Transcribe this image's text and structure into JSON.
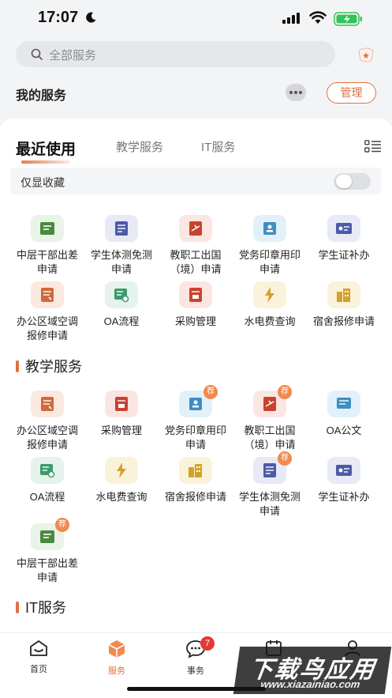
{
  "status": {
    "time": "17:07"
  },
  "search": {
    "placeholder": "全部服务"
  },
  "header": {
    "my_services": "我的服务",
    "manage_label": "管理"
  },
  "tabs": [
    {
      "label": "最近使用",
      "active": true
    },
    {
      "label": "教学服务",
      "active": false
    },
    {
      "label": "IT服务",
      "active": false
    }
  ],
  "favorites_toggle": {
    "label": "仅显收藏",
    "on": false
  },
  "recent": [
    {
      "label": "中层干部出差申请",
      "icon": "cadre-travel-icon",
      "color": "#e9f3e7",
      "accent": "#4a8a3f"
    },
    {
      "label": "学生体测免测申请",
      "icon": "fitness-exempt-icon",
      "color": "#e7e9f6",
      "accent": "#4d5aa6"
    },
    {
      "label": "教职工出国（境）申请",
      "icon": "abroad-icon",
      "color": "#fbe6e2",
      "accent": "#c8432f"
    },
    {
      "label": "党务印章用印申请",
      "icon": "seal-icon",
      "color": "#e2f1f9",
      "accent": "#3f8fbf"
    },
    {
      "label": "学生证补办",
      "icon": "student-card-icon",
      "color": "#e8eaf6",
      "accent": "#4d5aa6"
    },
    {
      "label": "办公区域空调报修申请",
      "icon": "ac-repair-icon",
      "color": "#fbe9df",
      "accent": "#d06a3c"
    },
    {
      "label": "OA流程",
      "icon": "oa-flow-icon",
      "color": "#e4f3ec",
      "accent": "#3c9b6b"
    },
    {
      "label": "采购管理",
      "icon": "purchase-icon",
      "color": "#fbe5e2",
      "accent": "#c8432f"
    },
    {
      "label": "水电费查询",
      "icon": "utility-bill-icon",
      "color": "#fbf2dc",
      "accent": "#d4a12a"
    },
    {
      "label": "宿舍报修申请",
      "icon": "dorm-repair-icon",
      "color": "#fbf2dc",
      "accent": "#d4a12a"
    }
  ],
  "teaching_section": {
    "title": "教学服务",
    "items": [
      {
        "label": "办公区域空调报修申请",
        "icon": "ac-repair-icon",
        "color": "#fbe9df",
        "accent": "#d06a3c",
        "badge": ""
      },
      {
        "label": "采购管理",
        "icon": "purchase-icon",
        "color": "#fbe5e2",
        "accent": "#c8432f",
        "badge": ""
      },
      {
        "label": "党务印章用印申请",
        "icon": "seal-icon",
        "color": "#e2f1f9",
        "accent": "#3f8fbf",
        "badge": "荐"
      },
      {
        "label": "教职工出国（境）申请",
        "icon": "abroad-icon",
        "color": "#fbe6e2",
        "accent": "#c8432f",
        "badge": "荐"
      },
      {
        "label": "OA公文",
        "icon": "oa-document-icon",
        "color": "#e2f1f9",
        "accent": "#3f8fbf",
        "badge": ""
      },
      {
        "label": "OA流程",
        "icon": "oa-flow-icon",
        "color": "#e4f3ec",
        "accent": "#3c9b6b",
        "badge": ""
      },
      {
        "label": "水电费查询",
        "icon": "utility-bill-icon",
        "color": "#fbf2dc",
        "accent": "#d4a12a",
        "badge": ""
      },
      {
        "label": "宿舍报修申请",
        "icon": "dorm-repair-icon",
        "color": "#fbf2dc",
        "accent": "#d4a12a",
        "badge": ""
      },
      {
        "label": "学生体测免测申请",
        "icon": "fitness-exempt-icon",
        "color": "#e7e9f6",
        "accent": "#4d5aa6",
        "badge": "荐"
      },
      {
        "label": "学生证补办",
        "icon": "student-card-icon",
        "color": "#e8eaf6",
        "accent": "#4d5aa6",
        "badge": ""
      },
      {
        "label": "中层干部出差申请",
        "icon": "cadre-travel-icon",
        "color": "#e9f3e7",
        "accent": "#4a8a3f",
        "badge": "荐"
      }
    ]
  },
  "it_section": {
    "title": "IT服务"
  },
  "bottom_nav": [
    {
      "label": "首页",
      "icon": "home-icon",
      "active": false,
      "badge": ""
    },
    {
      "label": "服务",
      "icon": "service-cube-icon",
      "active": true,
      "badge": ""
    },
    {
      "label": "事务",
      "icon": "message-icon",
      "active": false,
      "badge": "7"
    },
    {
      "label": "",
      "icon": "calendar-icon",
      "active": false,
      "badge": ""
    },
    {
      "label": "",
      "icon": "profile-icon",
      "active": false,
      "badge": ""
    }
  ],
  "watermark": {
    "title": "下载鸟应用",
    "url": "www.xiazainiao.com"
  },
  "colors": {
    "accent": "#e0703f",
    "badge_red": "#e53935",
    "recommend_badge": "#f08a4e"
  }
}
